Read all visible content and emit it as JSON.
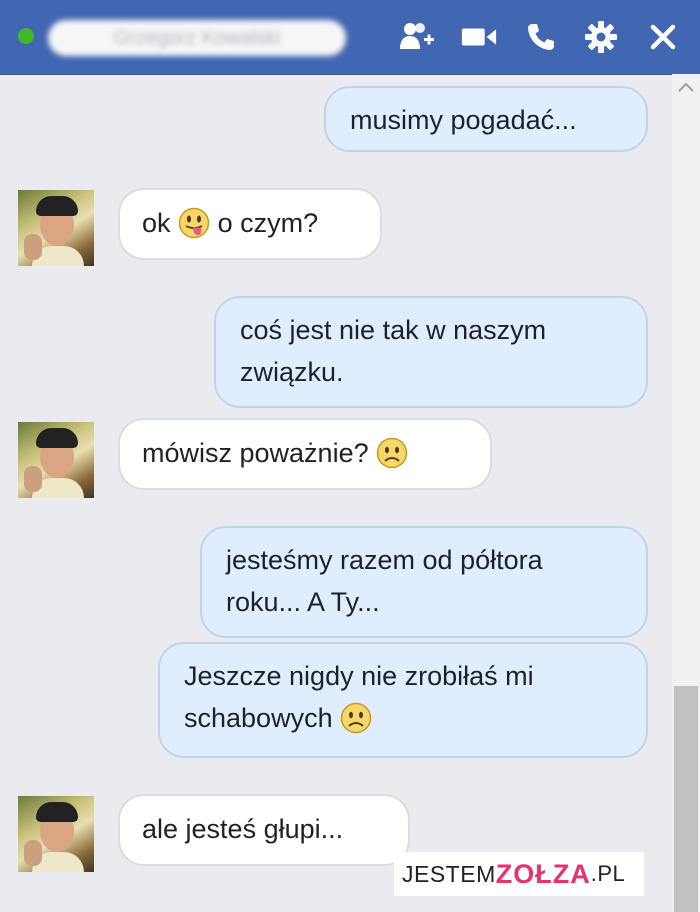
{
  "header": {
    "contact_name": "Grzegorz Kowalski",
    "bg_color": "#4267b2",
    "status_color": "#42b72a",
    "icons": [
      "add-person-icon",
      "video-camera-icon",
      "phone-icon",
      "gear-icon",
      "close-icon"
    ]
  },
  "messages": [
    {
      "from": "me",
      "text": "musimy pogadać..."
    },
    {
      "from": "them",
      "text_before": "ok",
      "emoji": "tongue-out-emoji",
      "text_after": "o czym?"
    },
    {
      "from": "me",
      "text": "coś jest nie tak w naszym związku."
    },
    {
      "from": "them",
      "text_before": "mówisz poważnie?",
      "emoji": "frown-emoji"
    },
    {
      "from": "me",
      "text": "jesteśmy razem od półtora roku... A Ty..."
    },
    {
      "from": "me",
      "text_before": "Jeszcze nigdy nie zrobiłaś mi schabowych",
      "emoji": "frown-emoji"
    },
    {
      "from": "them",
      "text": "ale jesteś głupi..."
    }
  ],
  "watermark": {
    "part1": "JESTEM",
    "part2": "ZOŁZA",
    "part3": ".PL"
  },
  "colors": {
    "outgoing_bubble": "#e0edff",
    "incoming_bubble": "#ffffff",
    "background": "#e9ebee"
  }
}
